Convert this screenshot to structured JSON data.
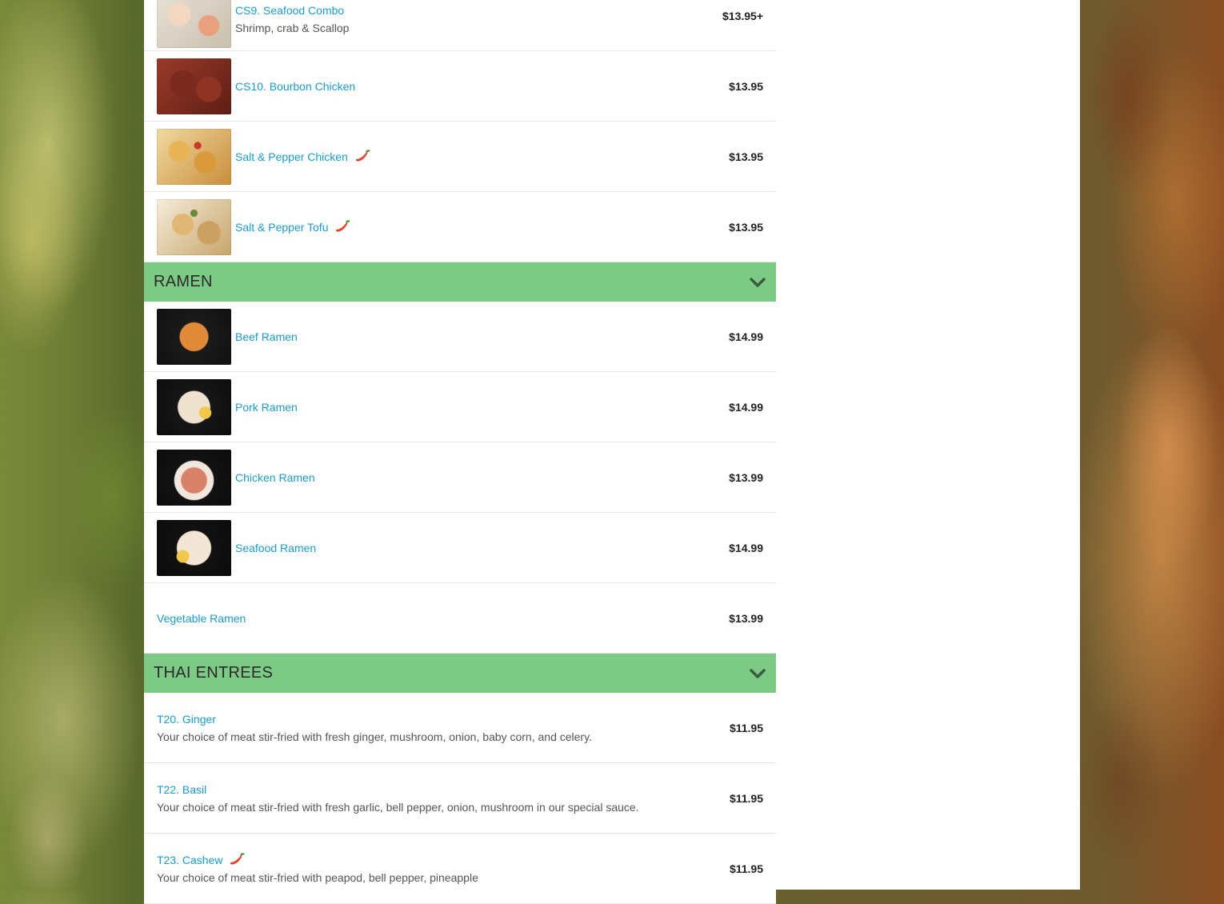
{
  "sections": [
    {
      "title": "",
      "items": [
        {
          "name": "CS9. Seafood Combo",
          "desc": "Shrimp, crab & Scallop",
          "price": "$13.95+",
          "spicy": false,
          "photo": "seafood-combo-photo"
        },
        {
          "name": "CS10. Bourbon Chicken",
          "desc": "",
          "price": "$13.95",
          "spicy": false,
          "photo": "bourbon-chicken-photo"
        },
        {
          "name": "Salt & Pepper Chicken",
          "desc": "",
          "price": "$13.95",
          "spicy": true,
          "photo": "salt-pepper-chicken-photo"
        },
        {
          "name": "Salt & Pepper Tofu",
          "desc": "",
          "price": "$13.95",
          "spicy": true,
          "photo": "salt-pepper-tofu-photo"
        }
      ]
    },
    {
      "title": "RAMEN",
      "items": [
        {
          "name": "Beef Ramen",
          "desc": "",
          "price": "$14.99",
          "spicy": false,
          "photo": "beef-ramen-photo"
        },
        {
          "name": "Pork Ramen",
          "desc": "",
          "price": "$14.99",
          "spicy": false,
          "photo": "pork-ramen-photo"
        },
        {
          "name": "Chicken Ramen",
          "desc": "",
          "price": "$13.99",
          "spicy": false,
          "photo": "chicken-ramen-photo"
        },
        {
          "name": "Seafood Ramen",
          "desc": "",
          "price": "$14.99",
          "spicy": false,
          "photo": "seafood-ramen-photo"
        },
        {
          "name": "Vegetable Ramen",
          "desc": "",
          "price": "$13.99",
          "spicy": false,
          "photo": ""
        }
      ]
    },
    {
      "title": "THAI ENTREES",
      "items": [
        {
          "name": "T20. Ginger",
          "desc": "Your choice of meat stir-fried with fresh ginger, mushroom, onion, baby corn, and celery.",
          "price": "$11.95",
          "spicy": false,
          "photo": ""
        },
        {
          "name": "T22. Basil",
          "desc": "Your choice of meat stir-fried with fresh garlic, bell pepper, onion, mushroom in our special sauce.",
          "price": "$11.95",
          "spicy": false,
          "photo": ""
        },
        {
          "name": "T23. Cashew",
          "desc": "Your choice of meat stir-fried with peapod, bell pepper, pineapple",
          "price": "$11.95",
          "spicy": true,
          "photo": ""
        }
      ]
    }
  ],
  "icons": {
    "spicy": "chili-pepper-icon",
    "expand": "chevron-down-icon"
  },
  "colors": {
    "section_bg": "#7dca86",
    "item_name": "#1a9bd1",
    "price": "#222222"
  }
}
